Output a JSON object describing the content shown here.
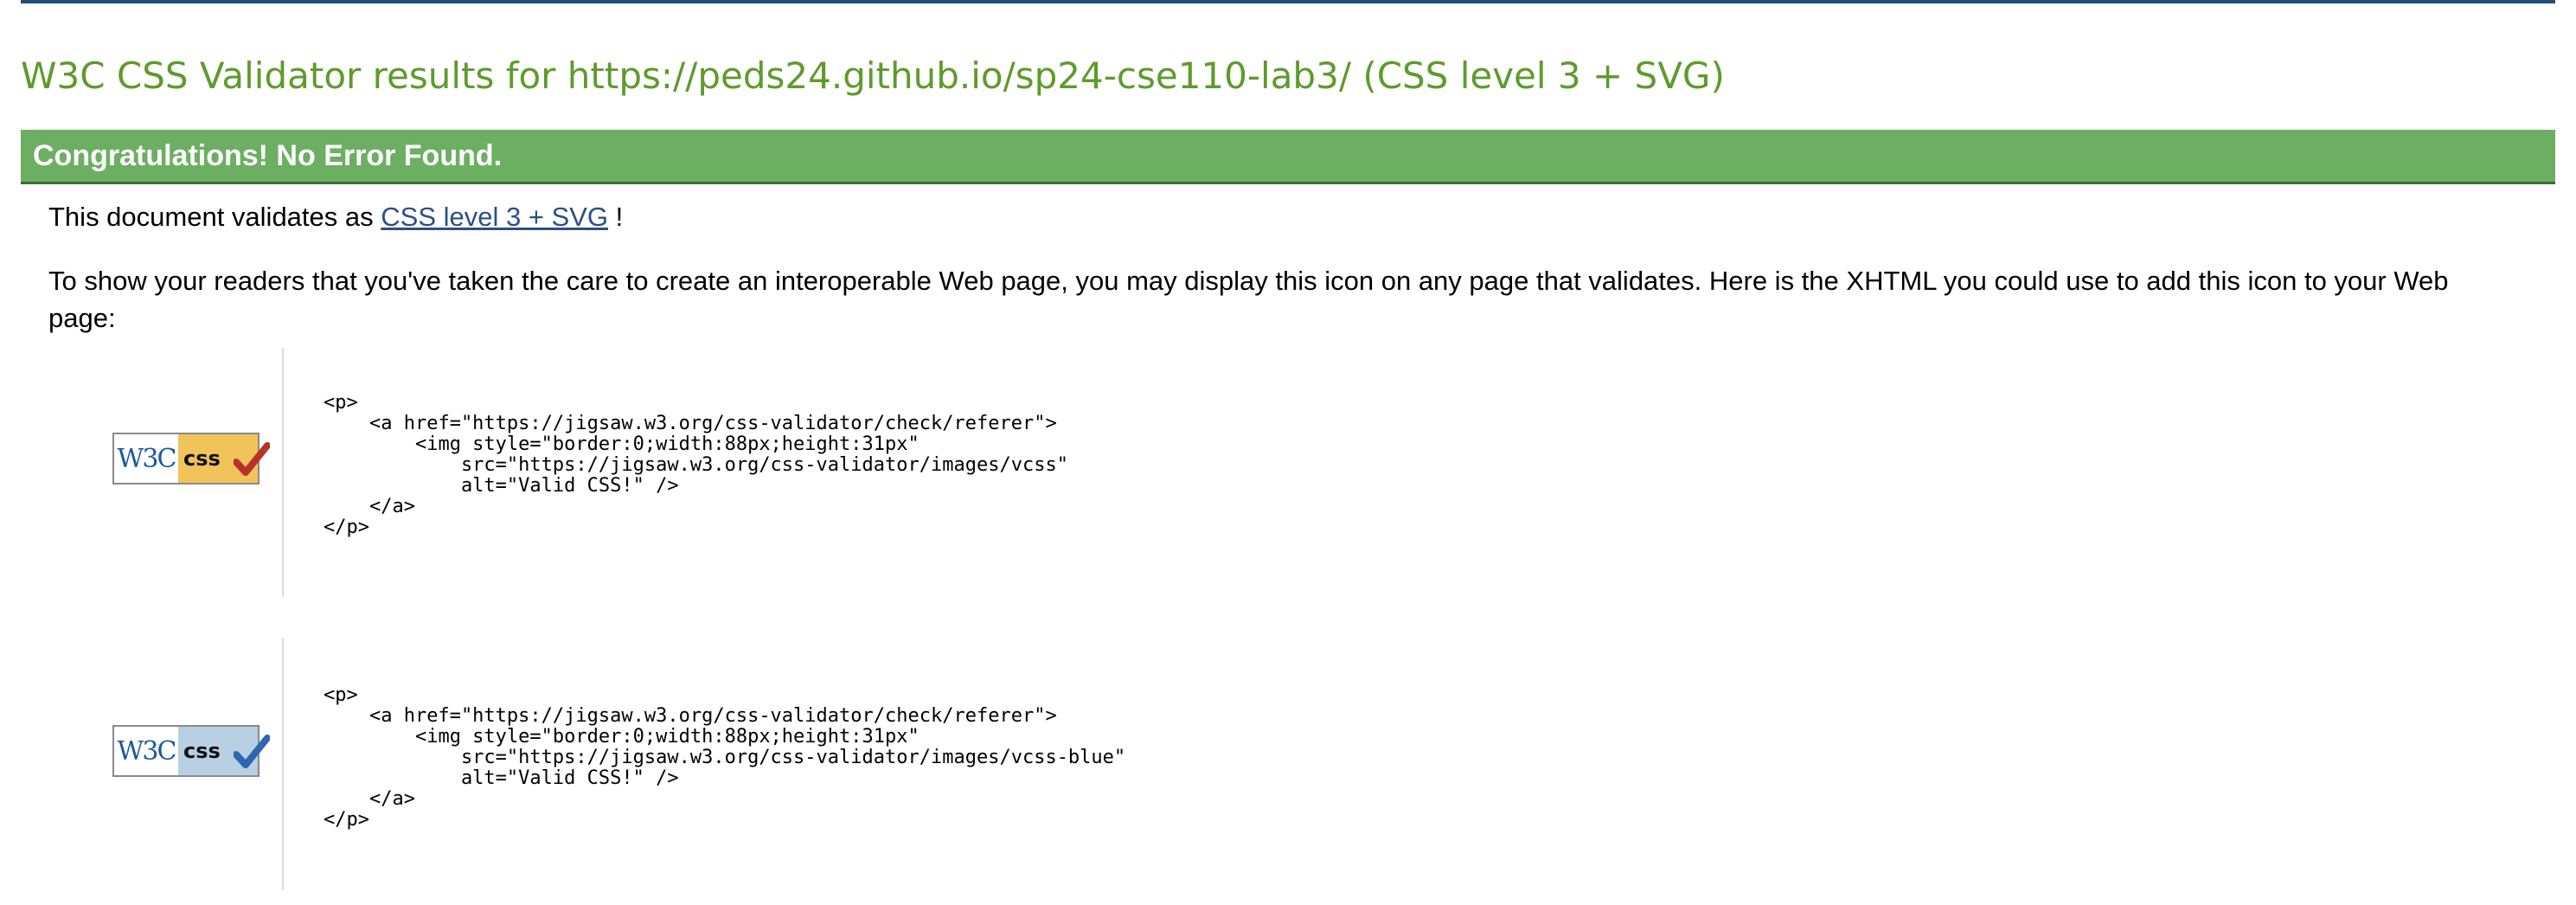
{
  "title": "W3C CSS Validator results for https://peds24.github.io/sp24-cse110-lab3/ (CSS level 3 + SVG)",
  "banner": "Congratulations! No Error Found.",
  "validates": {
    "prefix": "This document validates as ",
    "link": "CSS level 3 + SVG",
    "suffix": " !"
  },
  "readers_note": "To show your readers that you've taken the care to create an interoperable Web page, you may display this icon on any page that validates. Here is the XHTML you could use to add this icon to your Web page:",
  "badges": [
    {
      "w3c_text": "W3C",
      "css_text": "css",
      "check_icon": "red-check-icon",
      "code": "<p>\n    <a href=\"https://jigsaw.w3.org/css-validator/check/referer\">\n        <img style=\"border:0;width:88px;height:31px\"\n            src=\"https://jigsaw.w3.org/css-validator/images/vcss\"\n            alt=\"Valid CSS!\" />\n    </a>\n</p>"
    },
    {
      "w3c_text": "W3C",
      "css_text": "css",
      "check_icon": "blue-check-icon",
      "code": "<p>\n    <a href=\"https://jigsaw.w3.org/css-validator/check/referer\">\n        <img style=\"border:0;width:88px;height:31px\"\n            src=\"https://jigsaw.w3.org/css-validator/images/vcss-blue\"\n            alt=\"Valid CSS!\" />\n    </a>\n</p>"
    }
  ],
  "colors": {
    "title": "#5e9b2c",
    "banner_bg": "#6caf62",
    "banner_text": "#ffffff",
    "link": "#2c4f86",
    "top_rule": "#1f4e79",
    "check_red": "#b8322a",
    "check_blue": "#2f66b0"
  }
}
